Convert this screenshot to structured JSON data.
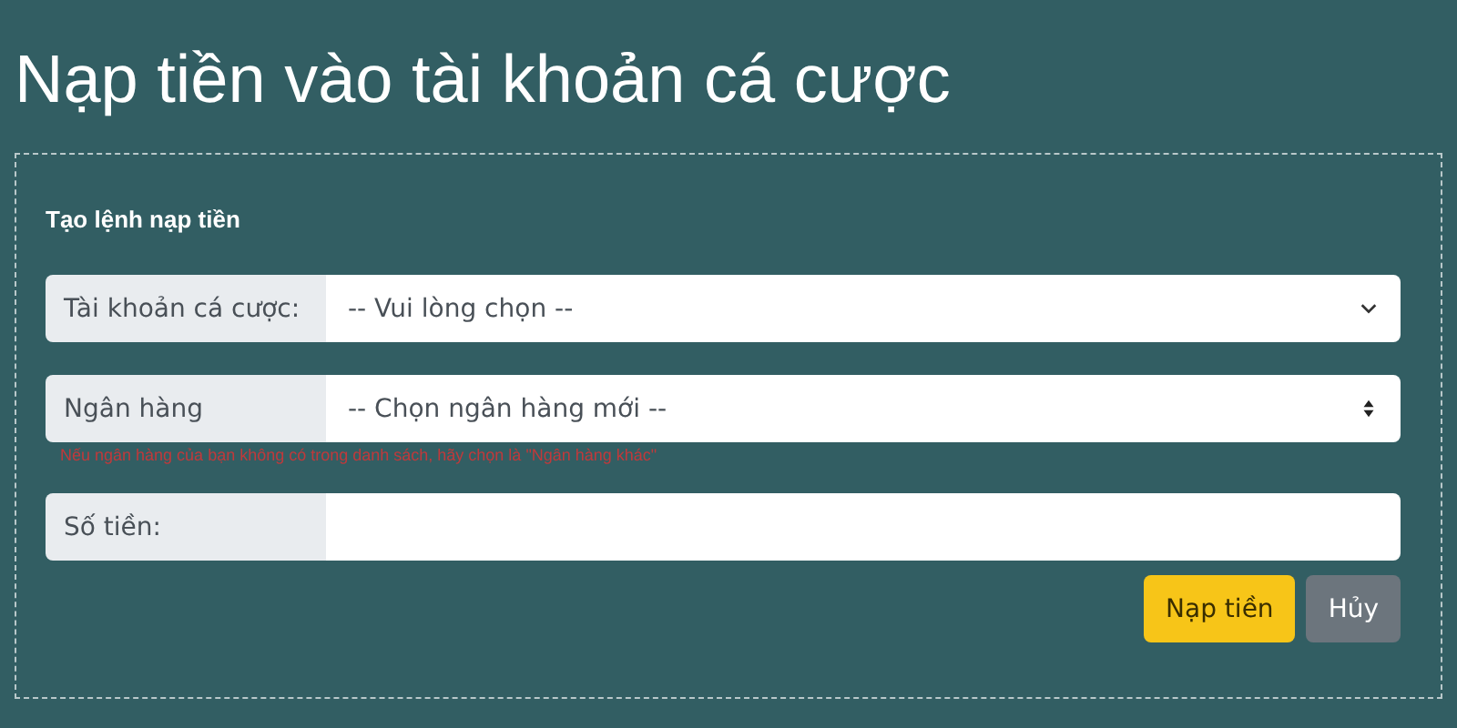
{
  "page": {
    "title": "Nạp tiền vào tài khoản cá cược"
  },
  "form": {
    "heading": "Tạo lệnh nạp tiền",
    "fields": [
      {
        "kind": "dropdown",
        "label": "Tài khoản cá cược:",
        "value": "-- Vui lòng chọn --"
      },
      {
        "kind": "spinner",
        "label": "Ngân hàng",
        "value": "-- Chọn ngân hàng mới --",
        "hint": "Nếu ngân hàng của bạn không có trong danh sách, hãy chọn là \"Ngân hàng khác\""
      },
      {
        "kind": "text",
        "label": "Số tiền:"
      }
    ],
    "buttons": [
      {
        "kind": "primary",
        "label": "Nạp tiền"
      },
      {
        "kind": "secondary",
        "label": "Hủy"
      }
    ]
  }
}
